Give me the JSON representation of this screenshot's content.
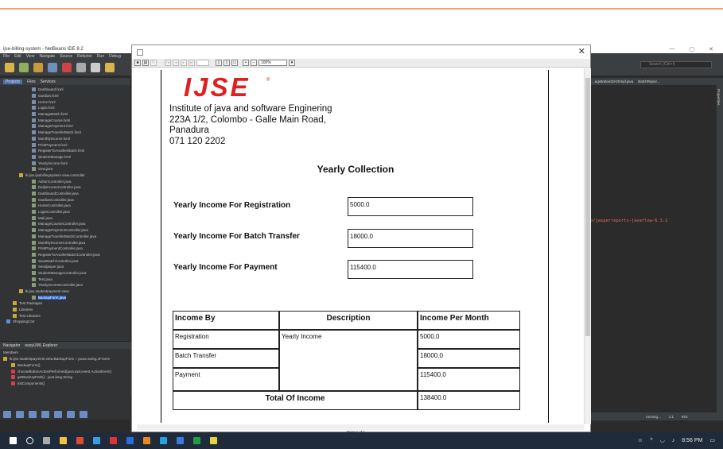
{
  "ide": {
    "title": "ijse-billing-system - NetBeans IDE 8.2",
    "menu": [
      "File",
      "Edit",
      "View",
      "Navigate",
      "Source",
      "Refactor",
      "Run",
      "Debug"
    ],
    "search_placeholder": "Search (Ctrl+I)",
    "panel_tabs": [
      "Projects",
      "Files",
      "Services"
    ],
    "tree": [
      "Dashboard.fxml",
      "Gardian.fxml",
      "Home.fxml",
      "Login.fxml",
      "ManageBatch.fxml",
      "ManageCourse.fxml",
      "ManagePayment.fxml",
      "ManageTransferBatch.fxml",
      "MonthlyIncome.fxml",
      "PrintPayment.fxml",
      "RegisterToAnotherBatch.fxml",
      "StudentManage.fxml",
      "YearlyIncome.fxml",
      "view.java",
      "lk.ijse.ijsebillingsystem.view.controller",
      "AdminController.java",
      "DailyIncomeController.java",
      "DashboardController.java",
      "GardianController.java",
      "HomeController.java",
      "LoginController.java",
      "Mail.java",
      "ManageCourseController.java",
      "ManagePaymentController.java",
      "ManageTransferBatchController.java",
      "MonthlyIncomeController.java",
      "PrintPaymentController.java",
      "RegisterToAnotherBatchController.java",
      "SaveBatchController.java",
      "Sendjasper.java",
      "StudentManageController.java",
      "Test.java",
      "YearlyIncomeController.java",
      "lk.ijse.studentpayment.view",
      "BackupForm.java",
      "Test Packages",
      "Libraries",
      "Test Libraries",
      "ShoppingCart"
    ],
    "navigator_tabs": [
      "Navigator",
      "easyUML Explorer"
    ],
    "navigator_filter": "Members",
    "navigator_items": [
      "lk.ijse.studentpayment.view.BackupForm :: javax.swing.JFrame",
      "BackupForm()",
      "chooseButtonActionPerformed(java.awt.event.ActionEvent)",
      "getBackUpPath() : java.lang.String",
      "initComponents()"
    ],
    "editor_tabs": [
      "...egistrationDAOImpl.java",
      "BatchRepor..."
    ],
    "editor_code": "b/jasperreports-javaflow-6.3.1",
    "side_label": "Properties",
    "status": {
      "position": "1:1",
      "mode": "INS",
      "running": "running..."
    }
  },
  "dialog": {
    "close_label": "✕",
    "zoom": "100%",
    "page_status": "Page 1 of 1"
  },
  "report": {
    "logo_text": "IJSE",
    "institute": [
      "Institute of java and software Enginering",
      "223A 1/2, Colombo - Galle Main Road,",
      "Panadura",
      "071 120 2202"
    ],
    "title": "Yearly  Collection",
    "fields": [
      {
        "label": "Yearly Income For Registration",
        "value": "5000.0"
      },
      {
        "label": "Yearly Income For Batch Transfer",
        "value": "18000.0"
      },
      {
        "label": "Yearly Income For Payment",
        "value": "115400.0"
      }
    ],
    "table": {
      "headers": [
        "Income By",
        "Description",
        "Income Per Month"
      ],
      "rows": [
        [
          "Registration",
          "Yearly Income",
          "5000.0"
        ],
        [
          "Batch Transfer",
          "",
          "18000.0"
        ],
        [
          "Payment",
          "",
          "115400.0"
        ]
      ],
      "total_label": "Total Of Income",
      "total_value": "138400.0"
    }
  },
  "taskbar": {
    "time": "8:56 PM"
  }
}
